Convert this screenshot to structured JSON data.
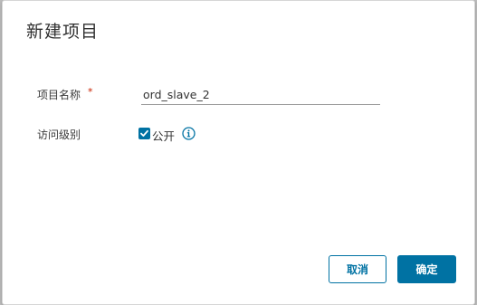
{
  "dialog": {
    "title": "新建项目"
  },
  "form": {
    "project_name": {
      "label": "项目名称",
      "required_marker": "*",
      "value": "ord_slave_2"
    },
    "access_level": {
      "label": "访问级别",
      "public_checkbox": {
        "label": "公开",
        "checked": true
      },
      "info_icon": "info-circle-icon"
    }
  },
  "footer": {
    "cancel_label": "取消",
    "ok_label": "确定"
  },
  "colors": {
    "accent": "#0072a3",
    "required": "#c92100",
    "text": "#333333"
  }
}
